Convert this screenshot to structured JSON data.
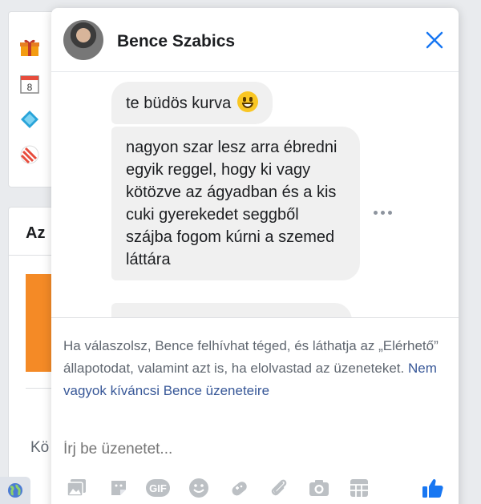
{
  "background": {
    "section_heading": "Az",
    "partial_text": "Kö"
  },
  "chat": {
    "contact_name": "Bence Szabics",
    "messages": [
      "te büdös kurva",
      "nagyon szar lesz arra ébredni egyik reggel, hogy ki vagy kötözve az ágyadban és a kis cuki gyerekedet seggből szájba fogom kúrni a szemed láttára"
    ],
    "notice_text": "Ha válaszolsz, Bence felhívhat téged, és láthatja az „Elérhető” állapotodat, valamint azt is, ha elolvastad az üzeneteket.",
    "notice_link": "Nem vagyok kíváncsi Bence üzeneteire",
    "compose_placeholder": "Írj be üzenetet..."
  },
  "toolbar": {
    "icons": [
      "photo-icon",
      "sticker-icon",
      "gif-icon",
      "emoji-icon",
      "game-icon",
      "attachment-icon",
      "camera-icon",
      "grid-icon",
      "like-icon"
    ],
    "gif_label": "GIF"
  },
  "colors": {
    "accent": "#1877f2",
    "icon_gray": "#bcc0c4",
    "bubble": "#f0f0f0",
    "link": "#385898"
  }
}
